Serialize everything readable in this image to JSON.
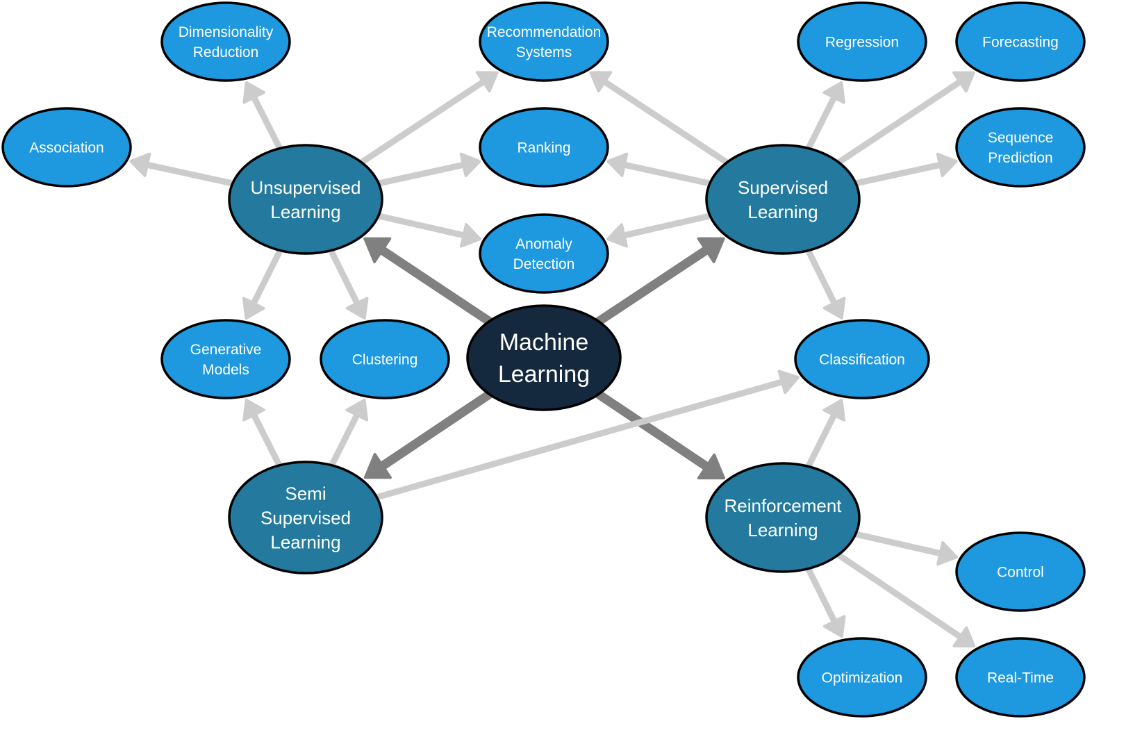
{
  "diagram": {
    "title": "Machine Learning",
    "colors": {
      "root_fill": "#15293e",
      "category_fill": "#237a9e",
      "leaf_fill": "#1e98df",
      "outline": "#000000",
      "primary_edge": "#808080",
      "secondary_edge": "#cccccc",
      "text": "#ffffff"
    },
    "nodes": [
      {
        "id": "ml",
        "kind": "root",
        "lines": [
          "Machine",
          "Learning"
        ]
      },
      {
        "id": "unsup",
        "kind": "category",
        "lines": [
          "Unsupervised",
          "Learning"
        ]
      },
      {
        "id": "sup",
        "kind": "category",
        "lines": [
          "Supervised",
          "Learning"
        ]
      },
      {
        "id": "semi",
        "kind": "category",
        "lines": [
          "Semi",
          "Supervised",
          "Learning"
        ]
      },
      {
        "id": "rl",
        "kind": "category",
        "lines": [
          "Reinforcement",
          "Learning"
        ]
      },
      {
        "id": "dimred",
        "kind": "leaf",
        "lines": [
          "Dimensionality",
          "Reduction"
        ]
      },
      {
        "id": "recsys",
        "kind": "leaf",
        "lines": [
          "Recommendation",
          "Systems"
        ]
      },
      {
        "id": "regression",
        "kind": "leaf",
        "lines": [
          "Regression"
        ]
      },
      {
        "id": "forecasting",
        "kind": "leaf",
        "lines": [
          "Forecasting"
        ]
      },
      {
        "id": "association",
        "kind": "leaf",
        "lines": [
          "Association"
        ]
      },
      {
        "id": "ranking",
        "kind": "leaf",
        "lines": [
          "Ranking"
        ]
      },
      {
        "id": "seqpred",
        "kind": "leaf",
        "lines": [
          "Sequence",
          "Prediction"
        ]
      },
      {
        "id": "anomaly",
        "kind": "leaf",
        "lines": [
          "Anomaly",
          "Detection"
        ]
      },
      {
        "id": "generative",
        "kind": "leaf",
        "lines": [
          "Generative",
          "Models"
        ]
      },
      {
        "id": "clustering",
        "kind": "leaf",
        "lines": [
          "Clustering"
        ]
      },
      {
        "id": "classification",
        "kind": "leaf",
        "lines": [
          "Classification"
        ]
      },
      {
        "id": "control",
        "kind": "leaf",
        "lines": [
          "Control"
        ]
      },
      {
        "id": "optimization",
        "kind": "leaf",
        "lines": [
          "Optimization"
        ]
      },
      {
        "id": "realtime",
        "kind": "leaf",
        "lines": [
          "Real-Time"
        ]
      }
    ],
    "edges": [
      {
        "from": "ml",
        "to": "unsup",
        "kind": "primary"
      },
      {
        "from": "ml",
        "to": "sup",
        "kind": "primary"
      },
      {
        "from": "ml",
        "to": "semi",
        "kind": "primary"
      },
      {
        "from": "ml",
        "to": "rl",
        "kind": "primary"
      },
      {
        "from": "unsup",
        "to": "dimred",
        "kind": "secondary"
      },
      {
        "from": "unsup",
        "to": "association",
        "kind": "secondary"
      },
      {
        "from": "unsup",
        "to": "recsys",
        "kind": "secondary"
      },
      {
        "from": "unsup",
        "to": "ranking",
        "kind": "secondary"
      },
      {
        "from": "unsup",
        "to": "anomaly",
        "kind": "secondary"
      },
      {
        "from": "unsup",
        "to": "generative",
        "kind": "secondary"
      },
      {
        "from": "unsup",
        "to": "clustering",
        "kind": "secondary"
      },
      {
        "from": "sup",
        "to": "recsys",
        "kind": "secondary"
      },
      {
        "from": "sup",
        "to": "ranking",
        "kind": "secondary"
      },
      {
        "from": "sup",
        "to": "anomaly",
        "kind": "secondary"
      },
      {
        "from": "sup",
        "to": "regression",
        "kind": "secondary"
      },
      {
        "from": "sup",
        "to": "forecasting",
        "kind": "secondary"
      },
      {
        "from": "sup",
        "to": "seqpred",
        "kind": "secondary"
      },
      {
        "from": "sup",
        "to": "classification",
        "kind": "secondary"
      },
      {
        "from": "semi",
        "to": "generative",
        "kind": "secondary"
      },
      {
        "from": "semi",
        "to": "clustering",
        "kind": "secondary"
      },
      {
        "from": "semi",
        "to": "classification",
        "kind": "secondary"
      },
      {
        "from": "rl",
        "to": "classification",
        "kind": "secondary"
      },
      {
        "from": "rl",
        "to": "control",
        "kind": "secondary"
      },
      {
        "from": "rl",
        "to": "optimization",
        "kind": "secondary"
      },
      {
        "from": "rl",
        "to": "realtime",
        "kind": "secondary"
      }
    ]
  }
}
